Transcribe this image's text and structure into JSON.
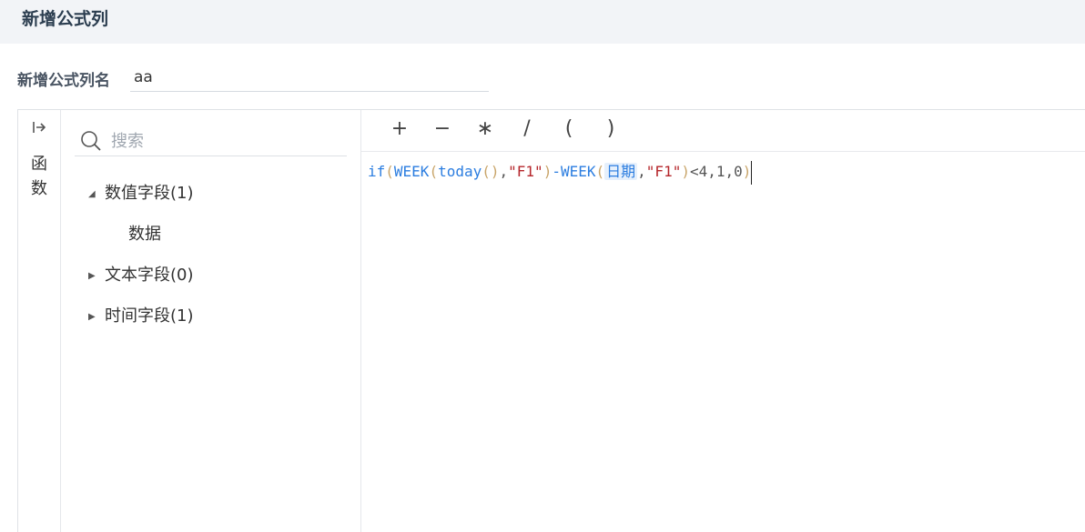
{
  "header": {
    "title": "新增公式列"
  },
  "name_field": {
    "label": "新增公式列名",
    "value": "aa"
  },
  "func_panel": {
    "label_line1": "函",
    "label_line2": "数"
  },
  "search": {
    "placeholder": "搜索"
  },
  "tree": [
    {
      "label": "数值字段(1)",
      "expanded": true
    },
    {
      "label": "数据"
    },
    {
      "label": "文本字段(0)",
      "expanded": false
    },
    {
      "label": "时间字段(1)",
      "expanded": false
    }
  ],
  "operators": [
    "+",
    "−",
    "∗",
    "/",
    "(",
    ")"
  ],
  "formula": {
    "tokens": [
      "if",
      "(",
      "WEEK",
      "(",
      "today",
      "()",
      ",",
      "\"F1\"",
      ")",
      "-",
      "WEEK",
      "(",
      "日期",
      ",",
      "\"F1\"",
      ")",
      "<4,1,0",
      ")"
    ]
  },
  "colors": {
    "function": "#2b7de0",
    "string": "#b5262b",
    "paren": "#c9a56a",
    "field_bg": "#e6f0fc"
  }
}
